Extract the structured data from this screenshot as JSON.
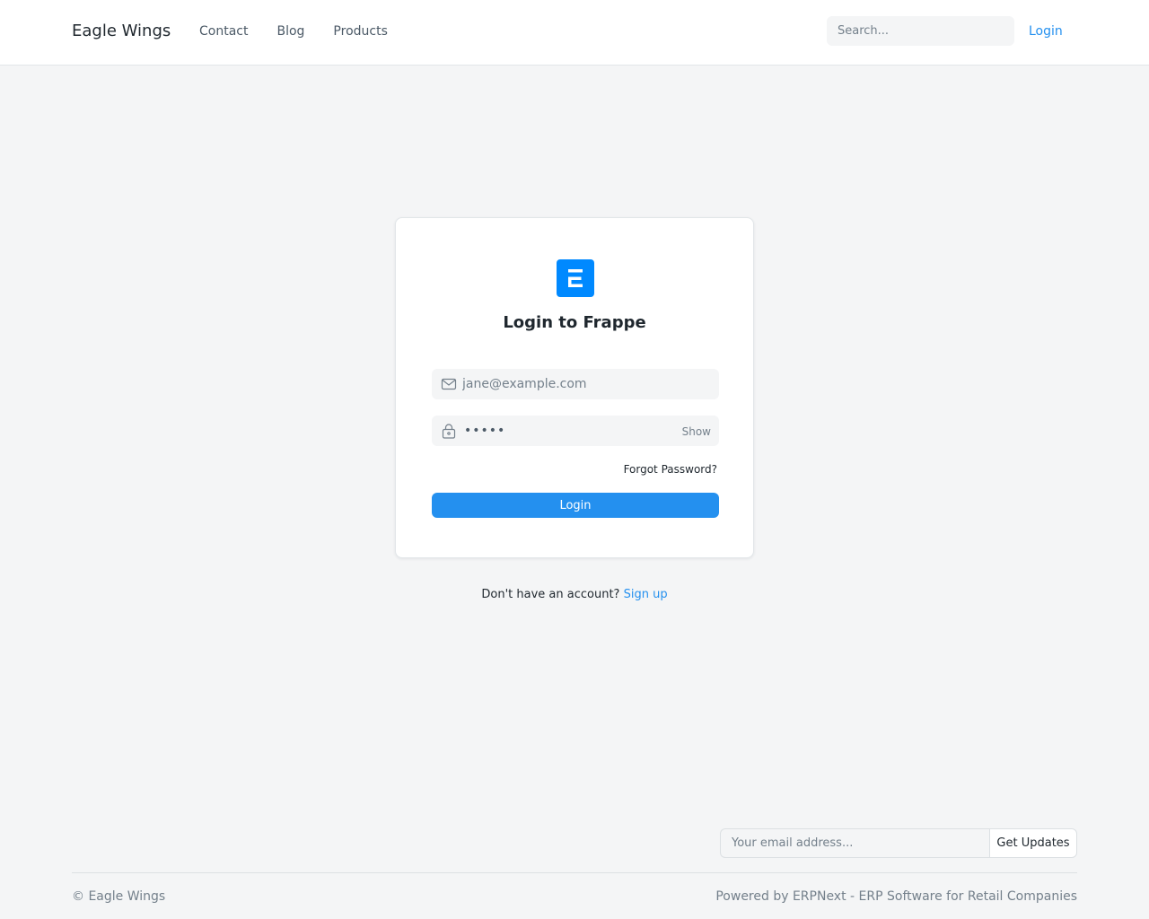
{
  "navbar": {
    "brand": "Eagle Wings",
    "links": [
      "Contact",
      "Blog",
      "Products"
    ],
    "search_placeholder": "Search...",
    "login_label": "Login"
  },
  "login_card": {
    "logo_icon": "frappe-logo-icon",
    "title": "Login to Frappe",
    "email_placeholder": "jane@example.com",
    "email_icon": "mail-icon",
    "password_value": "•••••",
    "password_icon": "lock-icon",
    "show_label": "Show",
    "forgot_label": "Forgot Password?",
    "login_button": "Login",
    "accent_color": "#2490ef"
  },
  "signup": {
    "prompt": "Don't have an account?",
    "link_label": "Sign up"
  },
  "footer": {
    "subscribe_placeholder": "Your email address...",
    "subscribe_button": "Get Updates",
    "copyright": "© Eagle Wings",
    "powered_by": "Powered by ERPNext - ERP Software for Retail Companies"
  }
}
